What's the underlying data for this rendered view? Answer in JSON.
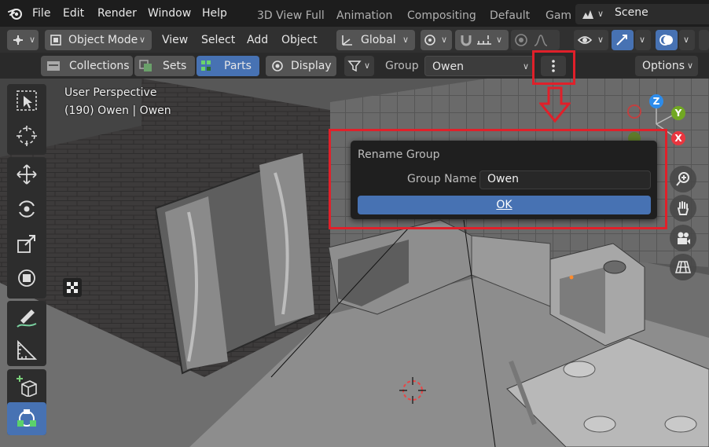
{
  "topbar": {
    "menu": [
      "File",
      "Edit",
      "Render",
      "Window",
      "Help"
    ],
    "workspaces": [
      "3D View Full",
      "Animation",
      "Compositing",
      "Default",
      "Gam"
    ],
    "scene": "Scene"
  },
  "header": {
    "mode": "Object Mode",
    "menus": [
      "View",
      "Select",
      "Add",
      "Object"
    ],
    "transform_orientation": "Global"
  },
  "subheader": {
    "tabs": [
      "Collections",
      "Sets",
      "Parts"
    ],
    "active_tab": "Parts",
    "display": "Display",
    "group_label": "Group",
    "group_value": "Owen",
    "options": "Options"
  },
  "viewport": {
    "view_name": "User Perspective",
    "object_info": "(190) Owen | Owen",
    "axes": [
      "Z",
      "Y",
      "X"
    ]
  },
  "dialog": {
    "title": "Rename Group",
    "field_label": "Group Name",
    "field_value": "Owen",
    "ok": "OK"
  },
  "colors": {
    "highlight": "#e0202a",
    "accent": "#4772b3",
    "axis_x": "#e8363f",
    "axis_y": "#71a822",
    "axis_z": "#2d8ceb"
  }
}
